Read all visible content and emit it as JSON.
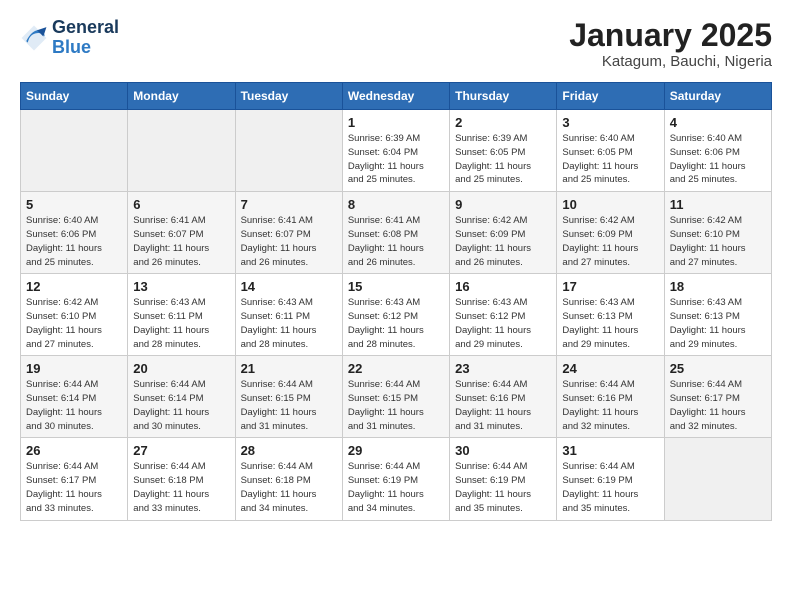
{
  "header": {
    "logo_line1": "General",
    "logo_line2": "Blue",
    "title": "January 2025",
    "subtitle": "Katagum, Bauchi, Nigeria"
  },
  "days_of_week": [
    "Sunday",
    "Monday",
    "Tuesday",
    "Wednesday",
    "Thursday",
    "Friday",
    "Saturday"
  ],
  "weeks": [
    [
      {
        "day": "",
        "info": ""
      },
      {
        "day": "",
        "info": ""
      },
      {
        "day": "",
        "info": ""
      },
      {
        "day": "1",
        "info": "Sunrise: 6:39 AM\nSunset: 6:04 PM\nDaylight: 11 hours\nand 25 minutes."
      },
      {
        "day": "2",
        "info": "Sunrise: 6:39 AM\nSunset: 6:05 PM\nDaylight: 11 hours\nand 25 minutes."
      },
      {
        "day": "3",
        "info": "Sunrise: 6:40 AM\nSunset: 6:05 PM\nDaylight: 11 hours\nand 25 minutes."
      },
      {
        "day": "4",
        "info": "Sunrise: 6:40 AM\nSunset: 6:06 PM\nDaylight: 11 hours\nand 25 minutes."
      }
    ],
    [
      {
        "day": "5",
        "info": "Sunrise: 6:40 AM\nSunset: 6:06 PM\nDaylight: 11 hours\nand 25 minutes."
      },
      {
        "day": "6",
        "info": "Sunrise: 6:41 AM\nSunset: 6:07 PM\nDaylight: 11 hours\nand 26 minutes."
      },
      {
        "day": "7",
        "info": "Sunrise: 6:41 AM\nSunset: 6:07 PM\nDaylight: 11 hours\nand 26 minutes."
      },
      {
        "day": "8",
        "info": "Sunrise: 6:41 AM\nSunset: 6:08 PM\nDaylight: 11 hours\nand 26 minutes."
      },
      {
        "day": "9",
        "info": "Sunrise: 6:42 AM\nSunset: 6:09 PM\nDaylight: 11 hours\nand 26 minutes."
      },
      {
        "day": "10",
        "info": "Sunrise: 6:42 AM\nSunset: 6:09 PM\nDaylight: 11 hours\nand 27 minutes."
      },
      {
        "day": "11",
        "info": "Sunrise: 6:42 AM\nSunset: 6:10 PM\nDaylight: 11 hours\nand 27 minutes."
      }
    ],
    [
      {
        "day": "12",
        "info": "Sunrise: 6:42 AM\nSunset: 6:10 PM\nDaylight: 11 hours\nand 27 minutes."
      },
      {
        "day": "13",
        "info": "Sunrise: 6:43 AM\nSunset: 6:11 PM\nDaylight: 11 hours\nand 28 minutes."
      },
      {
        "day": "14",
        "info": "Sunrise: 6:43 AM\nSunset: 6:11 PM\nDaylight: 11 hours\nand 28 minutes."
      },
      {
        "day": "15",
        "info": "Sunrise: 6:43 AM\nSunset: 6:12 PM\nDaylight: 11 hours\nand 28 minutes."
      },
      {
        "day": "16",
        "info": "Sunrise: 6:43 AM\nSunset: 6:12 PM\nDaylight: 11 hours\nand 29 minutes."
      },
      {
        "day": "17",
        "info": "Sunrise: 6:43 AM\nSunset: 6:13 PM\nDaylight: 11 hours\nand 29 minutes."
      },
      {
        "day": "18",
        "info": "Sunrise: 6:43 AM\nSunset: 6:13 PM\nDaylight: 11 hours\nand 29 minutes."
      }
    ],
    [
      {
        "day": "19",
        "info": "Sunrise: 6:44 AM\nSunset: 6:14 PM\nDaylight: 11 hours\nand 30 minutes."
      },
      {
        "day": "20",
        "info": "Sunrise: 6:44 AM\nSunset: 6:14 PM\nDaylight: 11 hours\nand 30 minutes."
      },
      {
        "day": "21",
        "info": "Sunrise: 6:44 AM\nSunset: 6:15 PM\nDaylight: 11 hours\nand 31 minutes."
      },
      {
        "day": "22",
        "info": "Sunrise: 6:44 AM\nSunset: 6:15 PM\nDaylight: 11 hours\nand 31 minutes."
      },
      {
        "day": "23",
        "info": "Sunrise: 6:44 AM\nSunset: 6:16 PM\nDaylight: 11 hours\nand 31 minutes."
      },
      {
        "day": "24",
        "info": "Sunrise: 6:44 AM\nSunset: 6:16 PM\nDaylight: 11 hours\nand 32 minutes."
      },
      {
        "day": "25",
        "info": "Sunrise: 6:44 AM\nSunset: 6:17 PM\nDaylight: 11 hours\nand 32 minutes."
      }
    ],
    [
      {
        "day": "26",
        "info": "Sunrise: 6:44 AM\nSunset: 6:17 PM\nDaylight: 11 hours\nand 33 minutes."
      },
      {
        "day": "27",
        "info": "Sunrise: 6:44 AM\nSunset: 6:18 PM\nDaylight: 11 hours\nand 33 minutes."
      },
      {
        "day": "28",
        "info": "Sunrise: 6:44 AM\nSunset: 6:18 PM\nDaylight: 11 hours\nand 34 minutes."
      },
      {
        "day": "29",
        "info": "Sunrise: 6:44 AM\nSunset: 6:19 PM\nDaylight: 11 hours\nand 34 minutes."
      },
      {
        "day": "30",
        "info": "Sunrise: 6:44 AM\nSunset: 6:19 PM\nDaylight: 11 hours\nand 35 minutes."
      },
      {
        "day": "31",
        "info": "Sunrise: 6:44 AM\nSunset: 6:19 PM\nDaylight: 11 hours\nand 35 minutes."
      },
      {
        "day": "",
        "info": ""
      }
    ]
  ]
}
